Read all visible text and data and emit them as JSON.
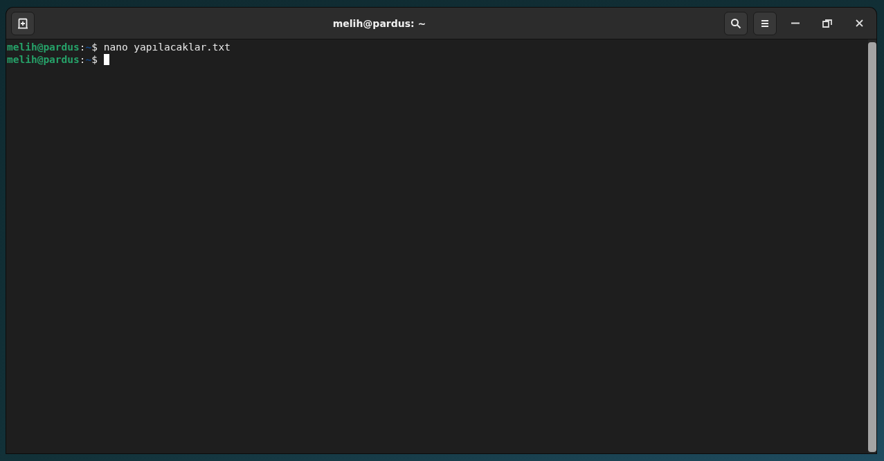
{
  "window": {
    "title": "melih@pardus: ~"
  },
  "terminal": {
    "lines": [
      {
        "user_host": "melih@pardus",
        "separator": ":",
        "path": "~",
        "symbol": "$",
        "command": "nano yapılacaklar.txt",
        "cursor": false
      },
      {
        "user_host": "melih@pardus",
        "separator": ":",
        "path": "~",
        "symbol": "$",
        "cursor": true
      }
    ]
  }
}
